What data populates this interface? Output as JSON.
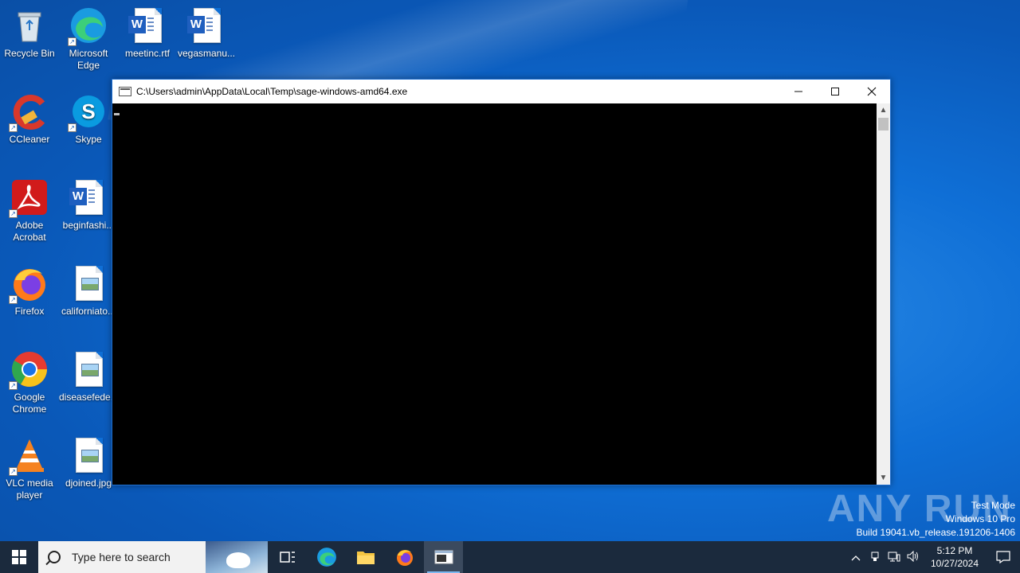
{
  "desktop": {
    "icons": [
      {
        "label": "Recycle Bin",
        "icon": "recycle-bin-icon"
      },
      {
        "label": "Microsoft Edge",
        "icon": "edge-icon"
      },
      {
        "label": "meetinc.rtf",
        "icon": "word-doc-icon"
      },
      {
        "label": "vegasmanu...",
        "icon": "word-doc-icon"
      },
      {
        "label": "CCleaner",
        "icon": "ccleaner-icon"
      },
      {
        "label": "Skype",
        "icon": "skype-icon"
      },
      {
        "label": "Adobe Acrobat",
        "icon": "acrobat-icon"
      },
      {
        "label": "beginfashi...",
        "icon": "word-doc-icon"
      },
      {
        "label": "Firefox",
        "icon": "firefox-icon"
      },
      {
        "label": "californiato...",
        "icon": "image-file-icon"
      },
      {
        "label": "Google Chrome",
        "icon": "chrome-icon"
      },
      {
        "label": "diseasefede...",
        "icon": "image-file-icon"
      },
      {
        "label": "VLC media player",
        "icon": "vlc-icon"
      },
      {
        "label": "djoined.jpg",
        "icon": "image-file-icon"
      }
    ]
  },
  "console": {
    "title": "C:\\Users\\admin\\AppData\\Local\\Temp\\sage-windows-amd64.exe",
    "minimize_symbol": "—",
    "maximize_symbol": "☐",
    "close_symbol": "✕",
    "scroll_up": "▲",
    "scroll_down": "▼"
  },
  "watermark": {
    "brand": "ANY RUN",
    "line1": "Test Mode",
    "line2": "Windows 10 Pro",
    "line3": "Build 19041.vb_release.191206-1406"
  },
  "taskbar": {
    "search_placeholder": "Type here to search",
    "apps": [
      "task-view",
      "edge",
      "file-explorer",
      "firefox",
      "console"
    ],
    "time": "5:12 PM",
    "date": "10/27/2024",
    "tray_up": "^"
  },
  "colors": {
    "desktop_blue": "#0f6fd6",
    "taskbar": "#1b2a3d",
    "console_bg": "#000000"
  }
}
